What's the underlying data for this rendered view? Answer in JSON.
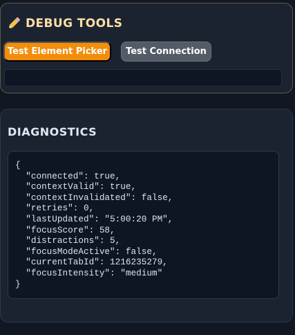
{
  "debug": {
    "icon": "pencil-icon",
    "title": "DEBUG TOOLS",
    "buttons": {
      "test_element_picker": "Test Element Picker",
      "test_connection": "Test Connection"
    },
    "status_text": ""
  },
  "diagnostics": {
    "title": "DIAGNOSTICS",
    "json_text": "{\n  \"connected\": true,\n  \"contextValid\": true,\n  \"contextInvalidated\": false,\n  \"retries\": 0,\n  \"lastUpdated\": \"5:00:20 PM\",\n  \"focusScore\": 58,\n  \"distractions\": 5,\n  \"focusModeActive\": false,\n  \"currentTabId\": 1216235279,\n  \"focusIntensity\": \"medium\"\n}"
  },
  "colors": {
    "background": "#111823",
    "panel": "#1b2330",
    "accent_orange": "#f28e0b",
    "button_gray": "#535b67",
    "debug_title": "#ffdfa4",
    "code_background": "#0e1624"
  }
}
